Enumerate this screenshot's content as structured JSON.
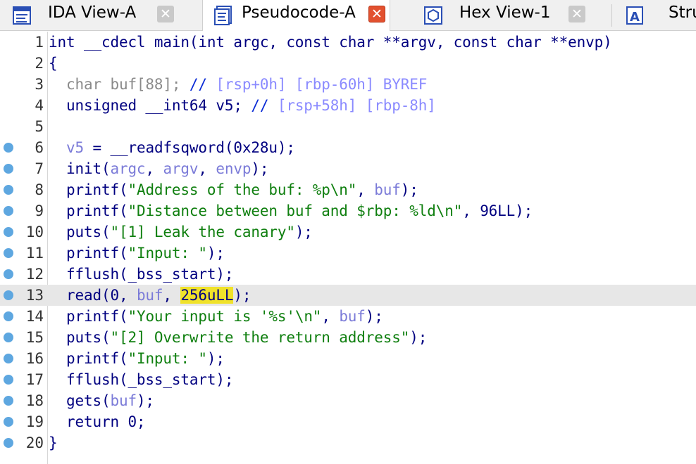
{
  "tabs": [
    {
      "label": "IDA View-A",
      "icon": "disassembly-view-icon",
      "active": false
    },
    {
      "label": "Pseudocode-A",
      "icon": "pseudocode-icon",
      "active": true
    },
    {
      "label": "Hex View-1",
      "icon": "hex-view-icon",
      "active": false
    },
    {
      "label": "Stru",
      "icon": "structures-icon",
      "active": false
    }
  ],
  "tab_close_glyph": "✕",
  "colors": {
    "breakpoint": "#5ea7e0",
    "highlight_line": "#e7e7e7",
    "selection": "#f0e22a",
    "active_close": "#e2512f"
  },
  "current_line": 13,
  "code": [
    {
      "n": "1",
      "bp": false,
      "tokens": [
        [
          "int __cdecl main(int argc, const char **argv, const char **envp)",
          "nv"
        ]
      ]
    },
    {
      "n": "2",
      "bp": false,
      "tokens": [
        [
          "{",
          "nv"
        ]
      ]
    },
    {
      "n": "3",
      "bp": false,
      "tokens": [
        [
          "  char buf[88]; ",
          "gr"
        ],
        [
          "// ",
          "cm"
        ],
        [
          "[rsp+0h] [rbp-60h] BYREF",
          "dim"
        ]
      ]
    },
    {
      "n": "4",
      "bp": false,
      "tokens": [
        [
          "  unsigned __int64 v5; ",
          "nv"
        ],
        [
          "// ",
          "cm"
        ],
        [
          "[rsp+58h] [rbp-8h]",
          "dim"
        ]
      ]
    },
    {
      "n": "5",
      "bp": false,
      "tokens": [
        [
          "",
          "nv"
        ]
      ]
    },
    {
      "n": "6",
      "bp": true,
      "tokens": [
        [
          "  ",
          "nv"
        ],
        [
          "v5",
          "var"
        ],
        [
          " = __readfsqword(0x28u);",
          "nv"
        ]
      ]
    },
    {
      "n": "7",
      "bp": true,
      "tokens": [
        [
          "  init(",
          "nv"
        ],
        [
          "argc",
          "var"
        ],
        [
          ", ",
          "nv"
        ],
        [
          "argv",
          "var"
        ],
        [
          ", ",
          "nv"
        ],
        [
          "envp",
          "var"
        ],
        [
          ");",
          "nv"
        ]
      ]
    },
    {
      "n": "8",
      "bp": true,
      "tokens": [
        [
          "  printf(",
          "nv"
        ],
        [
          "\"Address of the buf: %p\\n\"",
          "str"
        ],
        [
          ", ",
          "nv"
        ],
        [
          "buf",
          "var"
        ],
        [
          ");",
          "nv"
        ]
      ]
    },
    {
      "n": "9",
      "bp": true,
      "tokens": [
        [
          "  printf(",
          "nv"
        ],
        [
          "\"Distance between buf and $rbp: %ld\\n\"",
          "str"
        ],
        [
          ", 96LL);",
          "nv"
        ]
      ]
    },
    {
      "n": "10",
      "bp": true,
      "tokens": [
        [
          "  puts(",
          "nv"
        ],
        [
          "\"[1] Leak the canary\"",
          "str"
        ],
        [
          ");",
          "nv"
        ]
      ]
    },
    {
      "n": "11",
      "bp": true,
      "tokens": [
        [
          "  printf(",
          "nv"
        ],
        [
          "\"Input: \"",
          "str"
        ],
        [
          ");",
          "nv"
        ]
      ]
    },
    {
      "n": "12",
      "bp": true,
      "tokens": [
        [
          "  fflush(_bss_start);",
          "nv"
        ]
      ]
    },
    {
      "n": "13",
      "bp": true,
      "tokens": [
        [
          "  read(0, ",
          "nv"
        ],
        [
          "buf",
          "var"
        ],
        [
          ", ",
          "nv"
        ],
        [
          "256uLL",
          "sel"
        ],
        [
          ");",
          "nv"
        ]
      ]
    },
    {
      "n": "14",
      "bp": true,
      "tokens": [
        [
          "  printf(",
          "nv"
        ],
        [
          "\"Your input is '%s'\\n\"",
          "str"
        ],
        [
          ", ",
          "nv"
        ],
        [
          "buf",
          "var"
        ],
        [
          ");",
          "nv"
        ]
      ]
    },
    {
      "n": "15",
      "bp": true,
      "tokens": [
        [
          "  puts(",
          "nv"
        ],
        [
          "\"[2] Overwrite the return address\"",
          "str"
        ],
        [
          ");",
          "nv"
        ]
      ]
    },
    {
      "n": "16",
      "bp": true,
      "tokens": [
        [
          "  printf(",
          "nv"
        ],
        [
          "\"Input: \"",
          "str"
        ],
        [
          ");",
          "nv"
        ]
      ]
    },
    {
      "n": "17",
      "bp": true,
      "tokens": [
        [
          "  fflush(_bss_start);",
          "nv"
        ]
      ]
    },
    {
      "n": "18",
      "bp": true,
      "tokens": [
        [
          "  gets(",
          "nv"
        ],
        [
          "buf",
          "var"
        ],
        [
          ");",
          "nv"
        ]
      ]
    },
    {
      "n": "19",
      "bp": true,
      "tokens": [
        [
          "  return 0;",
          "nv"
        ]
      ]
    },
    {
      "n": "20",
      "bp": true,
      "tokens": [
        [
          "}",
          "nv"
        ]
      ]
    }
  ]
}
